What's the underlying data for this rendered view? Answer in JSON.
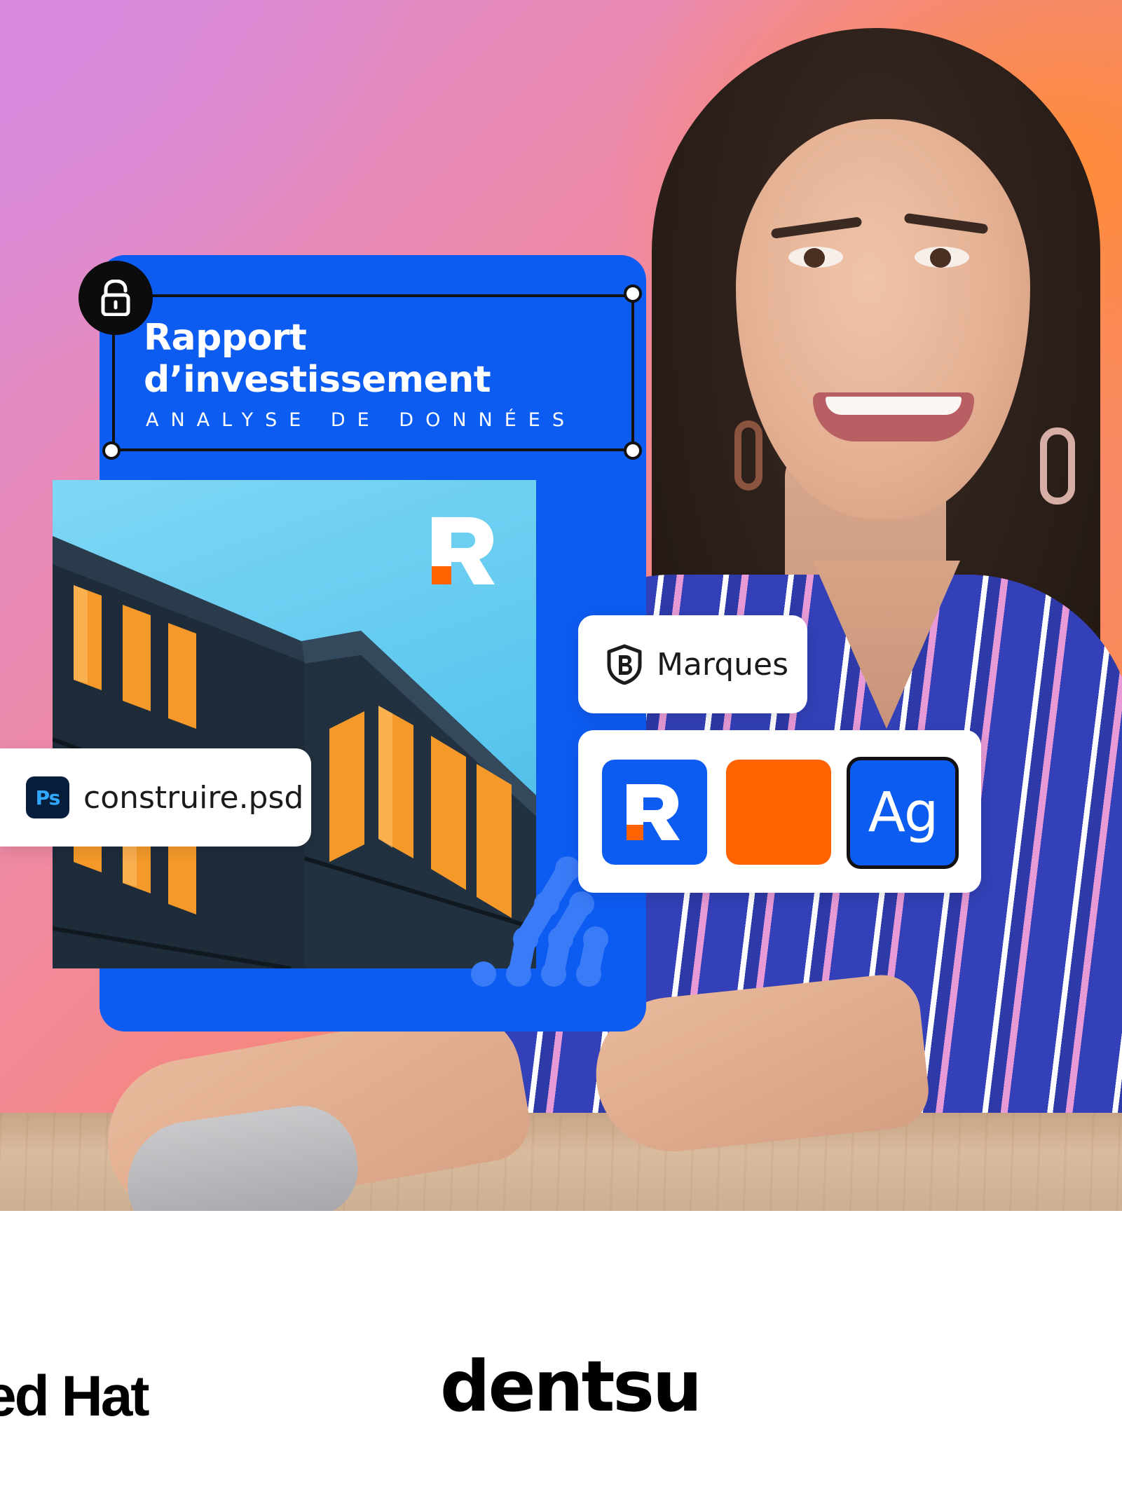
{
  "document_card": {
    "title_line1": "Rapport",
    "title_line2": "d’investissement",
    "subtitle": "ANALYSE DE DONNÉES",
    "lock_icon": "unlock-icon",
    "brand_logo_letter": "R"
  },
  "chips": {
    "file": {
      "icon": "photoshop-icon",
      "icon_label": "Ps",
      "label": "construire.psd"
    },
    "brands": {
      "icon": "brand-b-icon",
      "label": "Marques"
    }
  },
  "brand_swatches": {
    "logo_letter": "R",
    "font_sample": "Ag",
    "colors": {
      "primary": "#0d5cf2",
      "accent": "#ff6200"
    }
  },
  "partner_logos": {
    "redhat": "ed Hat",
    "dentsu": "dentsu"
  }
}
